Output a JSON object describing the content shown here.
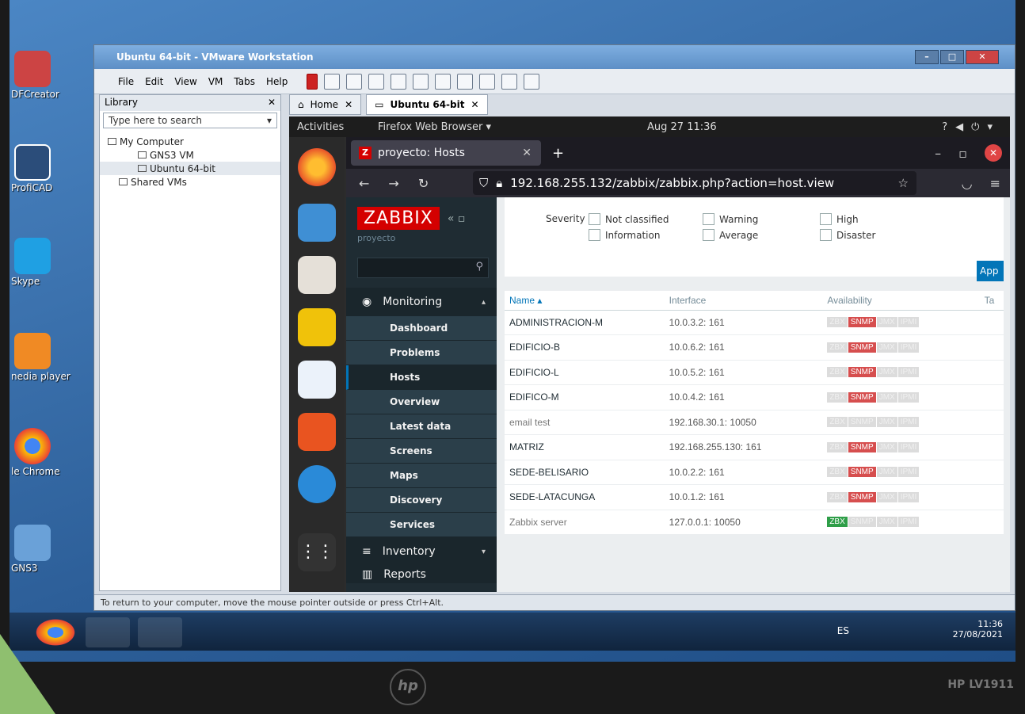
{
  "desktop_icons": [
    {
      "label": "DFCreator"
    },
    {
      "label": "ProfiCAD"
    },
    {
      "label": "Skype"
    },
    {
      "label": "nedia player"
    },
    {
      "label": "le Chrome"
    },
    {
      "label": "GNS3"
    }
  ],
  "vmware": {
    "title": "Ubuntu 64-bit - VMware Workstation",
    "menu": [
      "File",
      "Edit",
      "View",
      "VM",
      "Tabs",
      "Help"
    ],
    "library_title": "Library",
    "library_search_placeholder": "Type here to search",
    "tree": [
      "My Computer",
      "GNS3 VM",
      "Ubuntu 64-bit",
      "Shared VMs"
    ],
    "tabs": [
      {
        "label": "Home"
      },
      {
        "label": "Ubuntu 64-bit"
      }
    ],
    "status": "To return to your computer, move the mouse pointer outside or press Ctrl+Alt."
  },
  "gnome": {
    "activities": "Activities",
    "app": "Firefox Web Browser ▾",
    "clock": "Aug 27  11:36"
  },
  "firefox": {
    "tab_title": "proyecto: Hosts",
    "url": "192.168.255.132/zabbix/zabbix.php?action=host.view"
  },
  "zabbix": {
    "logo": "ZABBIX",
    "subtitle": "proyecto",
    "monitoring": "Monitoring",
    "menu": [
      "Dashboard",
      "Problems",
      "Hosts",
      "Overview",
      "Latest data",
      "Screens",
      "Maps",
      "Discovery",
      "Services"
    ],
    "inventory": "Inventory",
    "reports": "Reports",
    "severity_label": "Severity",
    "severities": [
      "Not classified",
      "Warning",
      "High",
      "Information",
      "Average",
      "Disaster"
    ],
    "apply": "App",
    "columns": [
      "Name ▴",
      "Interface",
      "Availability",
      "Ta"
    ],
    "hosts": [
      {
        "name": "ADMINISTRACION-M",
        "iface": "10.0.3.2: 161",
        "snmp": true,
        "zbx": false
      },
      {
        "name": "EDIFICIO-B",
        "iface": "10.0.6.2: 161",
        "snmp": true,
        "zbx": false
      },
      {
        "name": "EDIFICIO-L",
        "iface": "10.0.5.2: 161",
        "snmp": true,
        "zbx": false
      },
      {
        "name": "EDIFICO-M",
        "iface": "10.0.4.2: 161",
        "snmp": true,
        "zbx": false
      },
      {
        "name": "email test",
        "iface": "192.168.30.1: 10050",
        "snmp": false,
        "zbx": false
      },
      {
        "name": "MATRIZ",
        "iface": "192.168.255.130: 161",
        "snmp": true,
        "zbx": false
      },
      {
        "name": "SEDE-BELISARIO",
        "iface": "10.0.2.2: 161",
        "snmp": true,
        "zbx": false
      },
      {
        "name": "SEDE-LATACUNGA",
        "iface": "10.0.1.2: 161",
        "snmp": true,
        "zbx": false
      },
      {
        "name": "Zabbix server",
        "iface": "127.0.0.1: 10050",
        "snmp": false,
        "zbx": true
      }
    ],
    "badge_labels": [
      "ZBX",
      "SNMP",
      "JMX",
      "IPMI"
    ]
  },
  "taskbar": {
    "lang": "ES",
    "time": "11:36",
    "date": "27/08/2021"
  },
  "monitor": {
    "brand": "hp",
    "model": "HP LV1911"
  },
  "colors": {
    "zabbix_red": "#d40000",
    "snmp_red": "#d64e4e",
    "zbx_green": "#2e9e48",
    "zabbix_blue": "#0275b8"
  }
}
